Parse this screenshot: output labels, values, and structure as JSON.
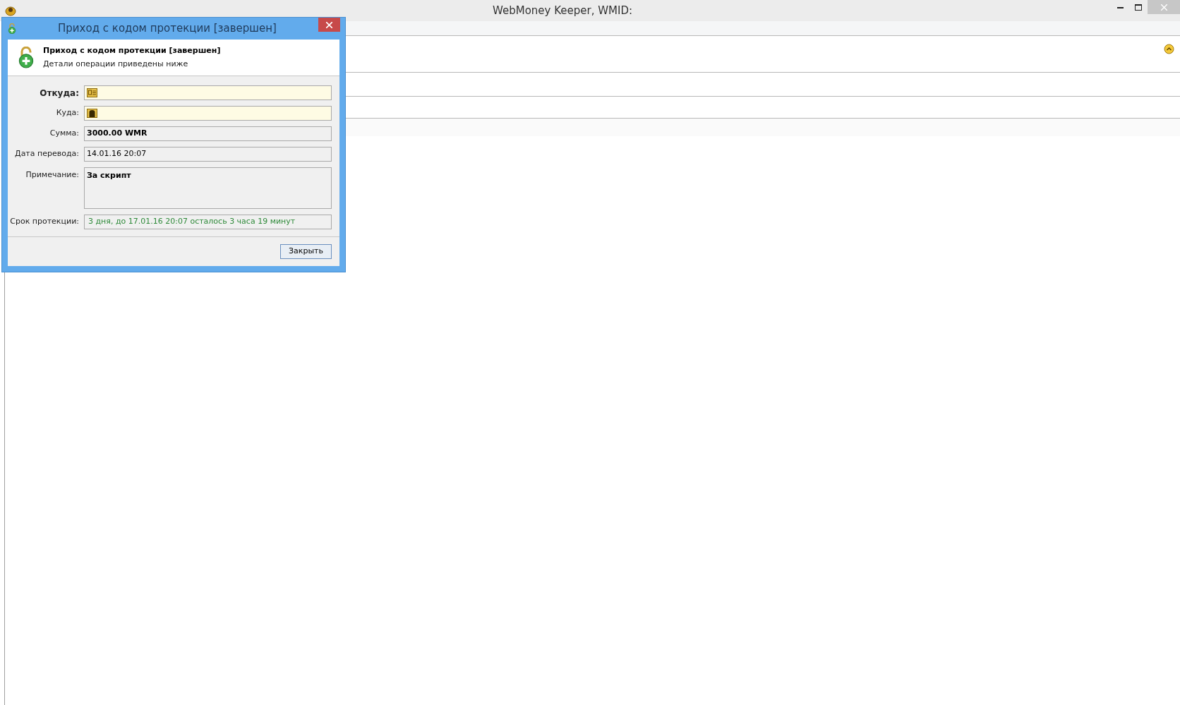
{
  "window": {
    "title": "WebMoney Keeper, WMID:"
  },
  "dialog": {
    "title": "Приход с кодом протекции [завершен]",
    "heading": "Приход с кодом протекции [завершен]",
    "subheading": "Детали операции приведены ниже",
    "fields": [
      {
        "kind": "purse",
        "label": "Откуда:",
        "label_bold": true
      },
      {
        "kind": "purse",
        "label": "Куда:",
        "label_bold": false
      },
      {
        "kind": "text",
        "label": "Сумма:",
        "value": "3000.00 WMR",
        "label_bold": false,
        "value_bold": true
      },
      {
        "kind": "text",
        "label": "Дата перевода:",
        "value": "14.01.16 20:07",
        "label_bold": false,
        "value_bold": false
      },
      {
        "kind": "memo",
        "label": "Примечание:",
        "value": "За скрипт",
        "label_bold": false,
        "value_bold": true
      },
      {
        "kind": "status",
        "label": "Срок протекции:",
        "value": "3 дня, до 17.01.16 20:07 осталось 3 часа 19 минут",
        "label_bold": false,
        "value_bold": false
      }
    ],
    "buttons": [
      "Закрыть"
    ]
  }
}
